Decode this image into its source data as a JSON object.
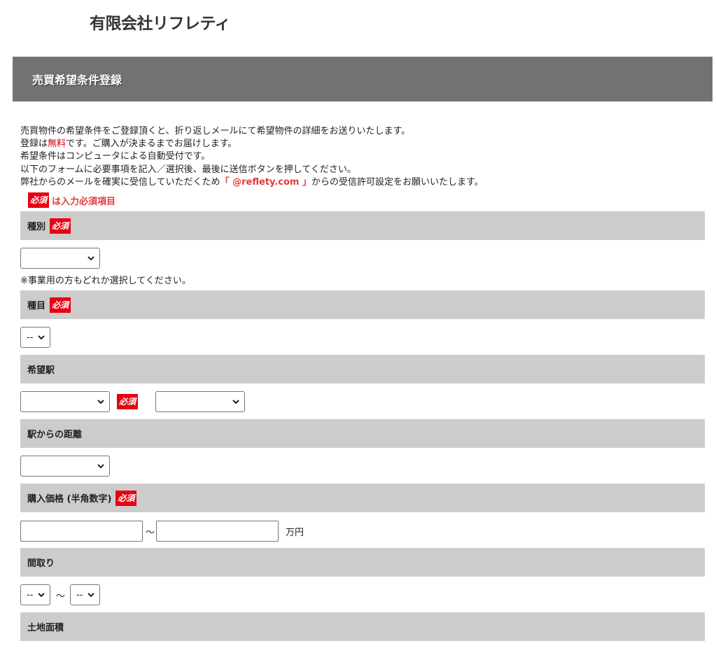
{
  "header": {
    "company_name": "有限会社リフレティ"
  },
  "banner": {
    "title": "売買希望条件登録"
  },
  "intro": {
    "line1": "売買物件の希望条件をご登録頂くと、折り返しメールにて希望物件の詳細をお送りいたします。",
    "line2_prefix": "登録は",
    "line2_highlight": "無料",
    "line2_suffix": "です。ご購入が決まるまでお届けします。",
    "line3": "希望条件はコンピュータによる自動受付です。",
    "line4": "以下のフォームに必要事項を記入／選択後、最後に送信ボタンを押してください。",
    "line5_prefix": "弊社からのメールを確実に受信していただくため",
    "line5_email": "「 @reflety.com 」",
    "line5_suffix": "からの受信許可設定をお願いいたします。"
  },
  "required_badge": "必須",
  "legend_text": "は入力必須項目",
  "sections": {
    "type": {
      "label": "種別",
      "selected": "",
      "note": "※事業用の方もどれか選択してください。"
    },
    "category": {
      "label": "種目",
      "selected": "--"
    },
    "station": {
      "label": "希望駅",
      "line_selected": "",
      "station_selected": ""
    },
    "distance": {
      "label": "駅からの距離",
      "selected": ""
    },
    "price": {
      "label": "購入価格 (半角数字)",
      "min_value": "",
      "max_value": "",
      "range_sep": "～",
      "unit": "万円"
    },
    "layout": {
      "label": "間取り",
      "min_selected": "--",
      "max_selected": "--",
      "range_sep": "～"
    },
    "land_area": {
      "label": "土地面積"
    }
  }
}
